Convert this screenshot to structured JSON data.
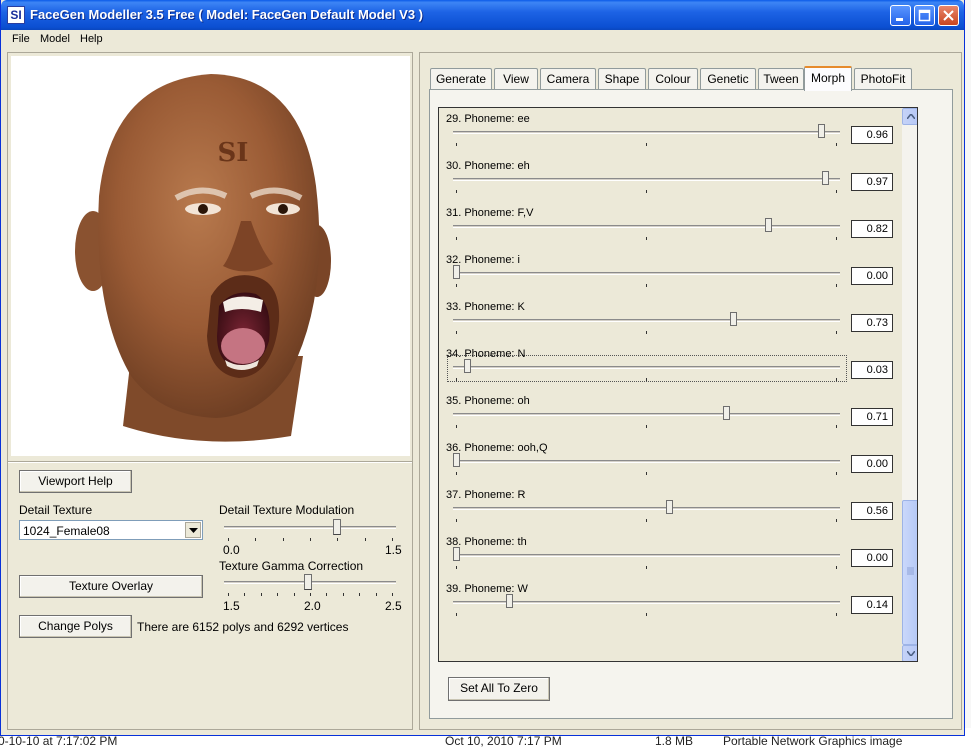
{
  "background": {
    "texts": [
      "0-10-10 at 7:17:02 PM",
      "Oct 10, 2010 7:17 PM",
      "1.8 MB",
      "Portable Network Graphics image"
    ]
  },
  "window": {
    "icon_text": "SI",
    "title": "FaceGen Modeller 3.5 Free  ( Model: FaceGen Default Model V3 )",
    "colors": {
      "titlebar": "#0b4fd2",
      "face": "#ece9d8",
      "accent_tab": "#e68b2c"
    }
  },
  "menu": {
    "items": [
      "File",
      "Model",
      "Help"
    ]
  },
  "viewport": {
    "forehead_text": "SI",
    "help_button": "Viewport Help"
  },
  "detail_texture": {
    "label": "Detail Texture",
    "selected": "1024_Female08"
  },
  "modulation": {
    "label": "Detail Texture Modulation",
    "min_label": "0.0",
    "max_label": "1.5",
    "min": 0.0,
    "max": 1.5,
    "value": 1.0
  },
  "texture_overlay": {
    "label": "Texture Overlay"
  },
  "gamma": {
    "label": "Texture Gamma Correction",
    "labels": [
      "1.5",
      "2.0",
      "2.5"
    ],
    "min": 1.5,
    "max": 2.5,
    "value": 1.99
  },
  "polys": {
    "button": "Change Polys",
    "info": "There are 6152 polys and 6292 vertices"
  },
  "tabs": [
    {
      "label": "Generate",
      "active": false
    },
    {
      "label": "View",
      "active": false
    },
    {
      "label": "Camera",
      "active": false
    },
    {
      "label": "Shape",
      "active": false
    },
    {
      "label": "Colour",
      "active": false
    },
    {
      "label": "Genetic",
      "active": false
    },
    {
      "label": "Tween",
      "active": false
    },
    {
      "label": "Morph",
      "active": true
    },
    {
      "label": "PhotoFit",
      "active": false
    }
  ],
  "morphs": [
    {
      "label": "29.  Phoneme: ee",
      "value": 0.96,
      "display": "0.96"
    },
    {
      "label": "30.  Phoneme: eh",
      "value": 0.97,
      "display": "0.97"
    },
    {
      "label": "31.  Phoneme: F,V",
      "value": 0.82,
      "display": "0.82"
    },
    {
      "label": "32.  Phoneme: i",
      "value": 0.0,
      "display": "0.00"
    },
    {
      "label": "33.  Phoneme: K",
      "value": 0.73,
      "display": "0.73"
    },
    {
      "label": "34.  Phoneme: N",
      "value": 0.03,
      "display": "0.03",
      "focused": true
    },
    {
      "label": "35.  Phoneme: oh",
      "value": 0.71,
      "display": "0.71"
    },
    {
      "label": "36.  Phoneme: ooh,Q",
      "value": 0.0,
      "display": "0.00"
    },
    {
      "label": "37.  Phoneme: R",
      "value": 0.56,
      "display": "0.56"
    },
    {
      "label": "38.  Phoneme: th",
      "value": 0.0,
      "display": "0.00"
    },
    {
      "label": "39.  Phoneme: W",
      "value": 0.14,
      "display": "0.14"
    }
  ],
  "set_zero": {
    "label": "Set All To Zero"
  }
}
